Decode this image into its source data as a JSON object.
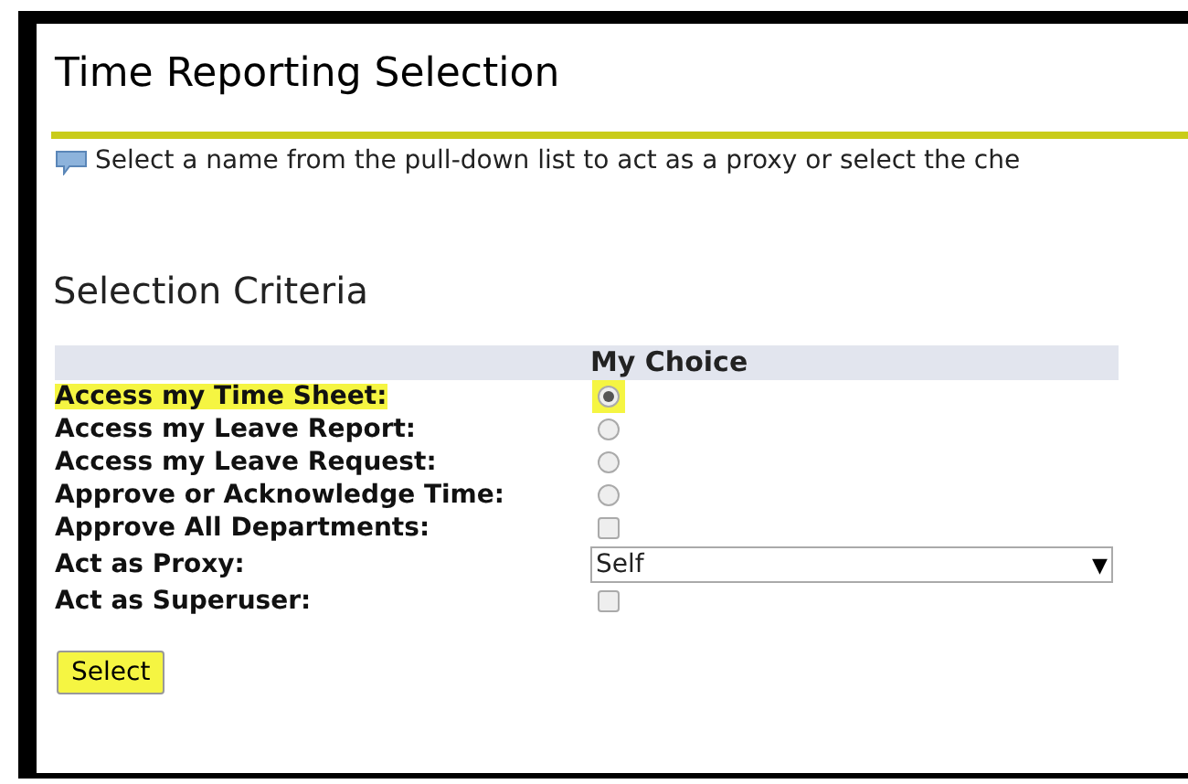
{
  "title": "Time Reporting Selection",
  "info": "Select a name from the pull-down list to act as a proxy or select the che",
  "section_title": "Selection Criteria",
  "column_header": "My Choice",
  "rows": [
    {
      "label": "Access my Time Sheet:",
      "kind": "radio",
      "selected": true,
      "highlighted": true
    },
    {
      "label": "Access my Leave Report:",
      "kind": "radio",
      "selected": false,
      "highlighted": false
    },
    {
      "label": "Access my Leave Request:",
      "kind": "radio",
      "selected": false,
      "highlighted": false
    },
    {
      "label": "Approve or Acknowledge Time:",
      "kind": "radio",
      "selected": false,
      "highlighted": false
    },
    {
      "label": "Approve All Departments:",
      "kind": "checkbox",
      "checked": false,
      "highlighted": false
    },
    {
      "label": "Act as Proxy:",
      "kind": "select",
      "value": "Self",
      "arrow": "▼",
      "highlighted": false
    },
    {
      "label": "Act as Superuser:",
      "kind": "checkbox",
      "checked": false,
      "highlighted": false
    }
  ],
  "select_button": {
    "label": "Select",
    "highlighted": true
  }
}
